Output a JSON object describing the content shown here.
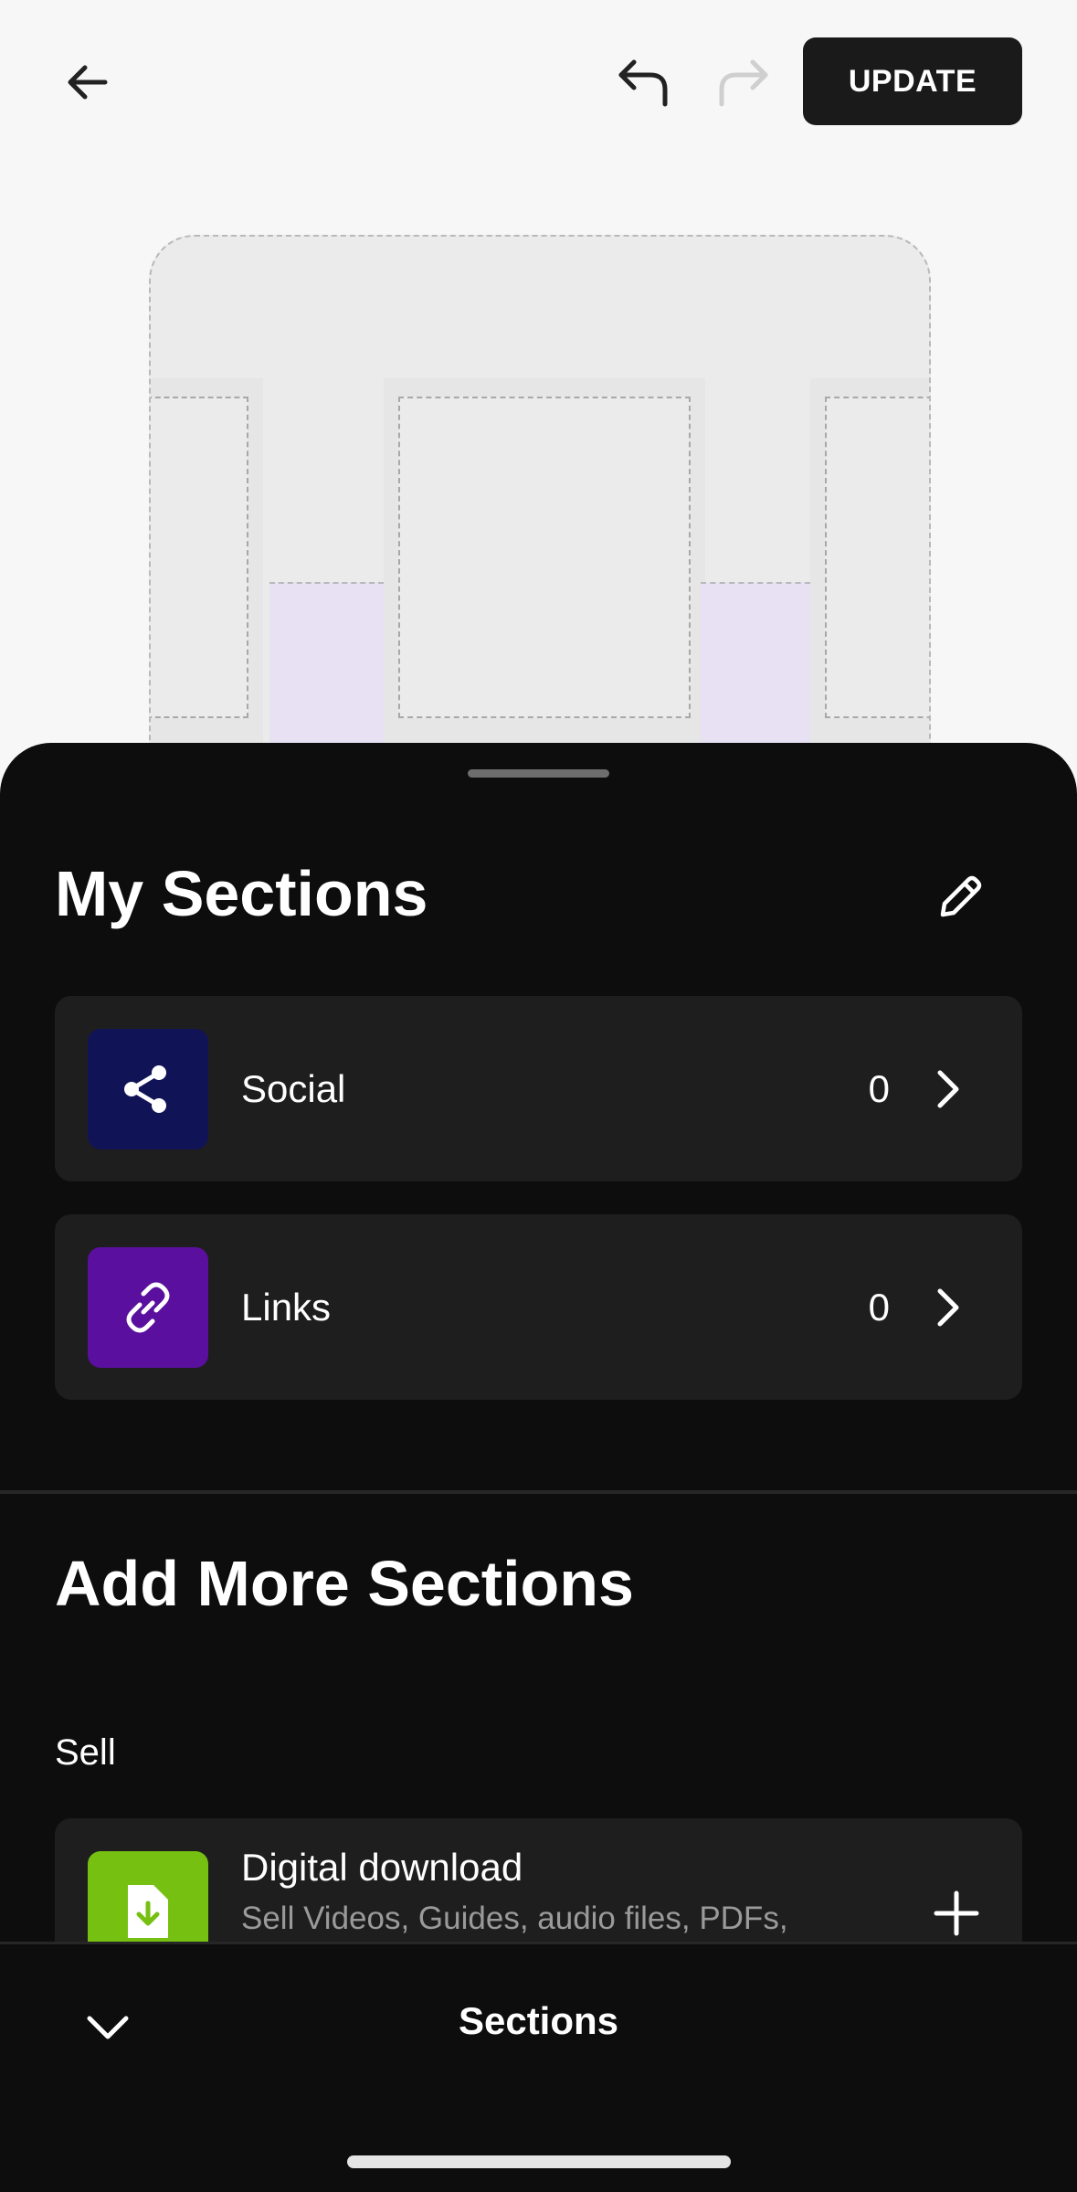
{
  "top_bar": {
    "back_icon": "arrow-left-icon",
    "undo_icon": "undo-icon",
    "redo_icon": "redo-icon",
    "update_label": "UPDATE"
  },
  "sheet": {
    "my_sections_title": "My Sections",
    "edit_icon": "pencil-icon",
    "my_sections": [
      {
        "label": "Social",
        "count": "0",
        "icon": "share-icon",
        "color": "#111357"
      },
      {
        "label": "Links",
        "count": "0",
        "icon": "link-icon",
        "color": "#5a0f9e"
      }
    ],
    "add_more_title": "Add More Sections",
    "sell_heading": "Sell",
    "add_items": [
      {
        "title": "Digital download",
        "description": "Sell Videos, Guides, audio files, PDFs,",
        "icon": "download-file-icon",
        "color": "#76c012"
      }
    ]
  },
  "footer": {
    "collapse_icon": "chevron-down-icon",
    "title": "Sections"
  },
  "colors": {
    "sheet_bg": "#0d0d0d",
    "row_bg": "#1e1e1e",
    "update_bg": "#1a1a1a"
  }
}
